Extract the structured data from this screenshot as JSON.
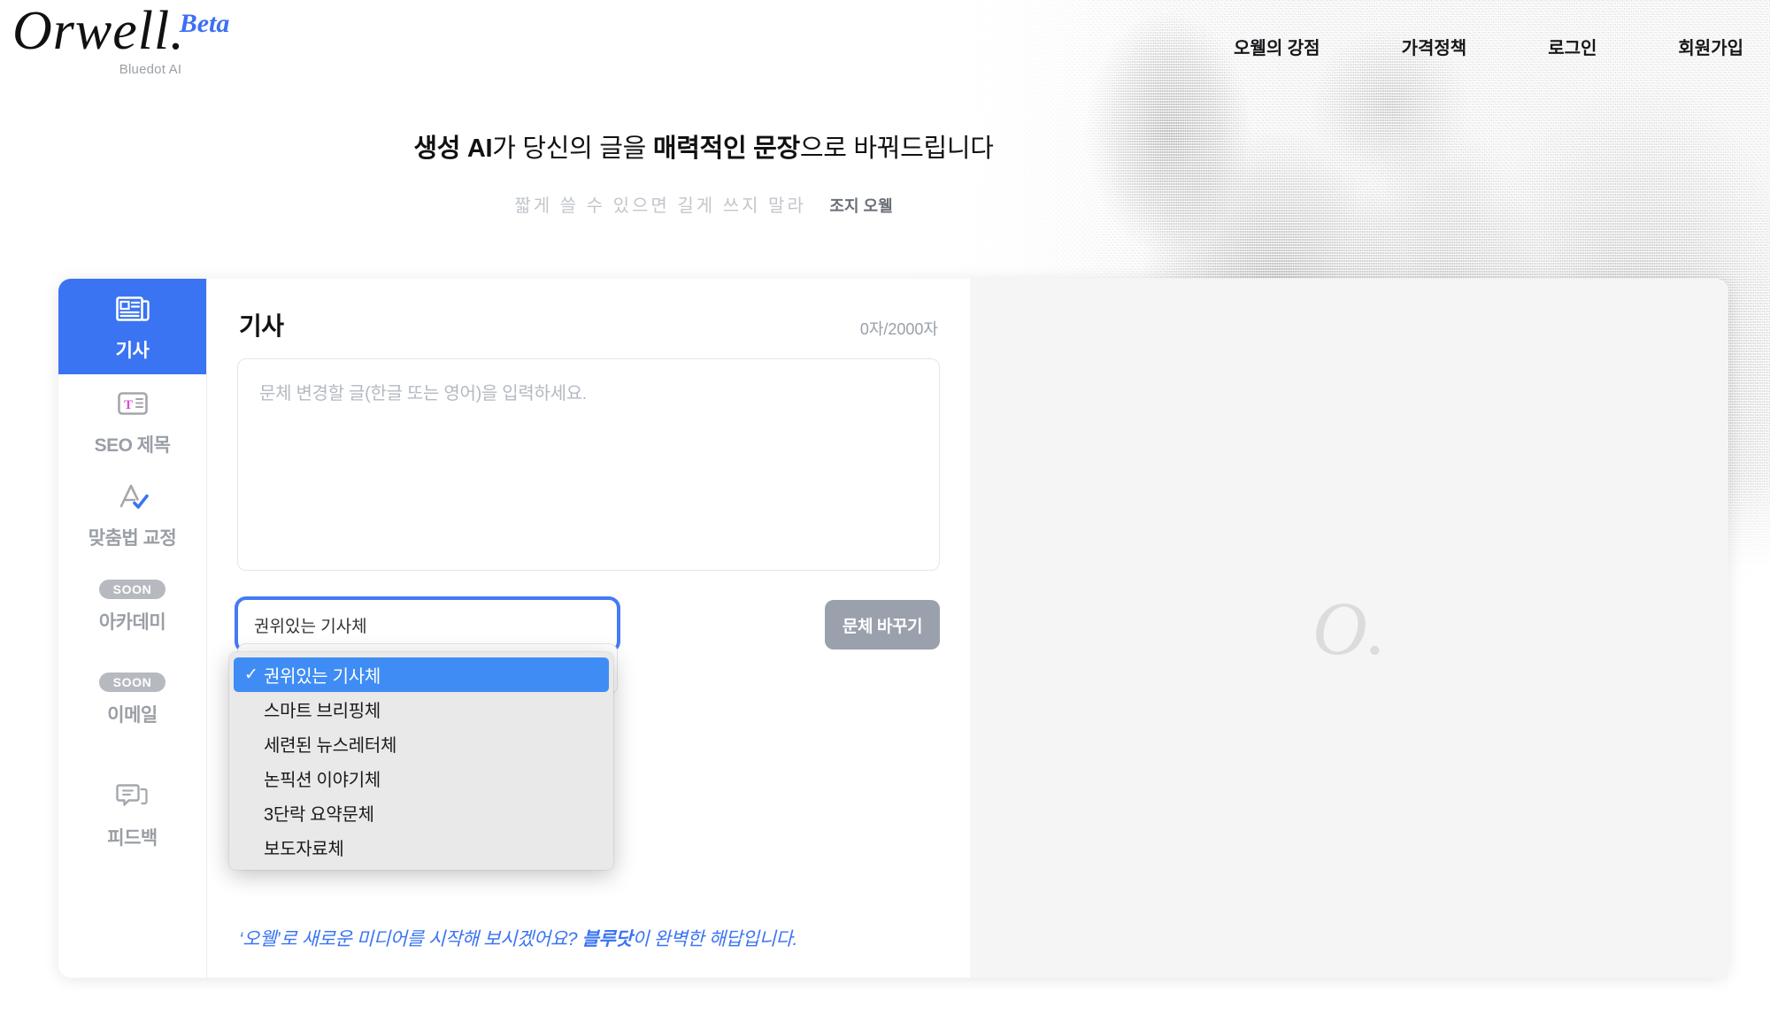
{
  "brand": {
    "logo_main": "Orwell.",
    "logo_beta": "Beta",
    "logo_sub": "Bluedot AI",
    "watermark": "O.",
    "accent_blue": "#3b74f2",
    "active_blue": "#3f8cf4",
    "muted_gray": "#9a9ea5"
  },
  "nav": {
    "items": [
      {
        "label": "오웰의 강점"
      },
      {
        "label": "가격정책"
      },
      {
        "label": "로그인"
      },
      {
        "label": "회원가입"
      }
    ]
  },
  "hero": {
    "headline_part1": "생성 AI",
    "headline_part2": "가 당신의 글을 ",
    "headline_part3": "매력적인 문장",
    "headline_part4": "으로 바꿔드립니다",
    "quote": "짧게 쓸 수 있으면 길게 쓰지 말라",
    "author": "조지 오웰"
  },
  "sidebar": {
    "items": [
      {
        "label": "기사",
        "icon": "newspaper-icon",
        "active": true,
        "badge": ""
      },
      {
        "label": "SEO 제목",
        "icon": "text-heading-icon",
        "active": false,
        "badge": ""
      },
      {
        "label": "맞춤법 교정",
        "icon": "spellcheck-icon",
        "active": false,
        "badge": ""
      },
      {
        "label": "아카데미",
        "icon": "",
        "active": false,
        "badge": "SOON"
      },
      {
        "label": "이메일",
        "icon": "",
        "active": false,
        "badge": "SOON"
      },
      {
        "label": "피드백",
        "icon": "feedback-icon",
        "active": false,
        "badge": ""
      }
    ]
  },
  "editor": {
    "title": "기사",
    "char_count": "0자/2000자",
    "textarea_placeholder": "문체 변경할 글(한글 또는 영어)을 입력하세요.",
    "textarea_value": "",
    "run_button": "문체 바꾸기",
    "style_selected": "권위있는 기사체",
    "promo_part1": "‘오웰’로 새로운 미디어를 시작해 보시겠어요? ",
    "promo_brand": "블루닷",
    "promo_part2": "이 완벽한 해답입니다."
  },
  "style_dropdown": {
    "open": true,
    "checkmark": "✓",
    "options": [
      {
        "label": "권위있는 기사체",
        "selected": true
      },
      {
        "label": "스마트 브리핑체",
        "selected": false
      },
      {
        "label": "세련된 뉴스레터체",
        "selected": false
      },
      {
        "label": "논픽션 이야기체",
        "selected": false
      },
      {
        "label": "3단락 요약문체",
        "selected": false
      },
      {
        "label": "보도자료체",
        "selected": false
      }
    ]
  }
}
